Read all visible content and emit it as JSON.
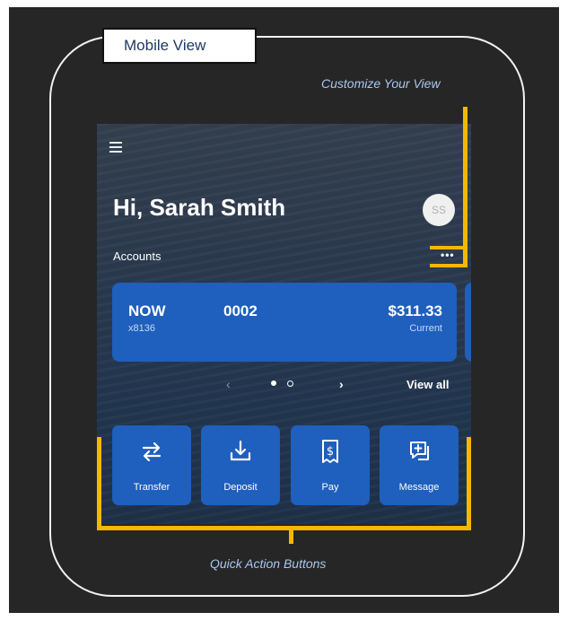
{
  "labels": {
    "mobile_view": "Mobile View",
    "customize": "Customize Your View",
    "quick_actions": "Quick Action Buttons"
  },
  "app": {
    "greeting": "Hi, Sarah Smith",
    "avatar_initials": "SS",
    "accounts_label": "Accounts",
    "more_label": "•••",
    "view_all": "View all",
    "pager": {
      "prev": "‹",
      "next": "›",
      "current_page": 1,
      "total_pages": 2
    }
  },
  "account_card": {
    "name": "NOW",
    "masked_number": "x8136",
    "number": "0002",
    "balance": "$311.33",
    "balance_type": "Current"
  },
  "quick_actions": [
    {
      "label": "Transfer",
      "icon": "transfer-icon"
    },
    {
      "label": "Deposit",
      "icon": "deposit-icon"
    },
    {
      "label": "Pay",
      "icon": "pay-bill-icon"
    },
    {
      "label": "Message",
      "icon": "message-icon"
    }
  ],
  "colors": {
    "accent_blue": "#1f5fbd",
    "highlight": "#f5b800",
    "annotation_text": "#a8c8f2"
  }
}
